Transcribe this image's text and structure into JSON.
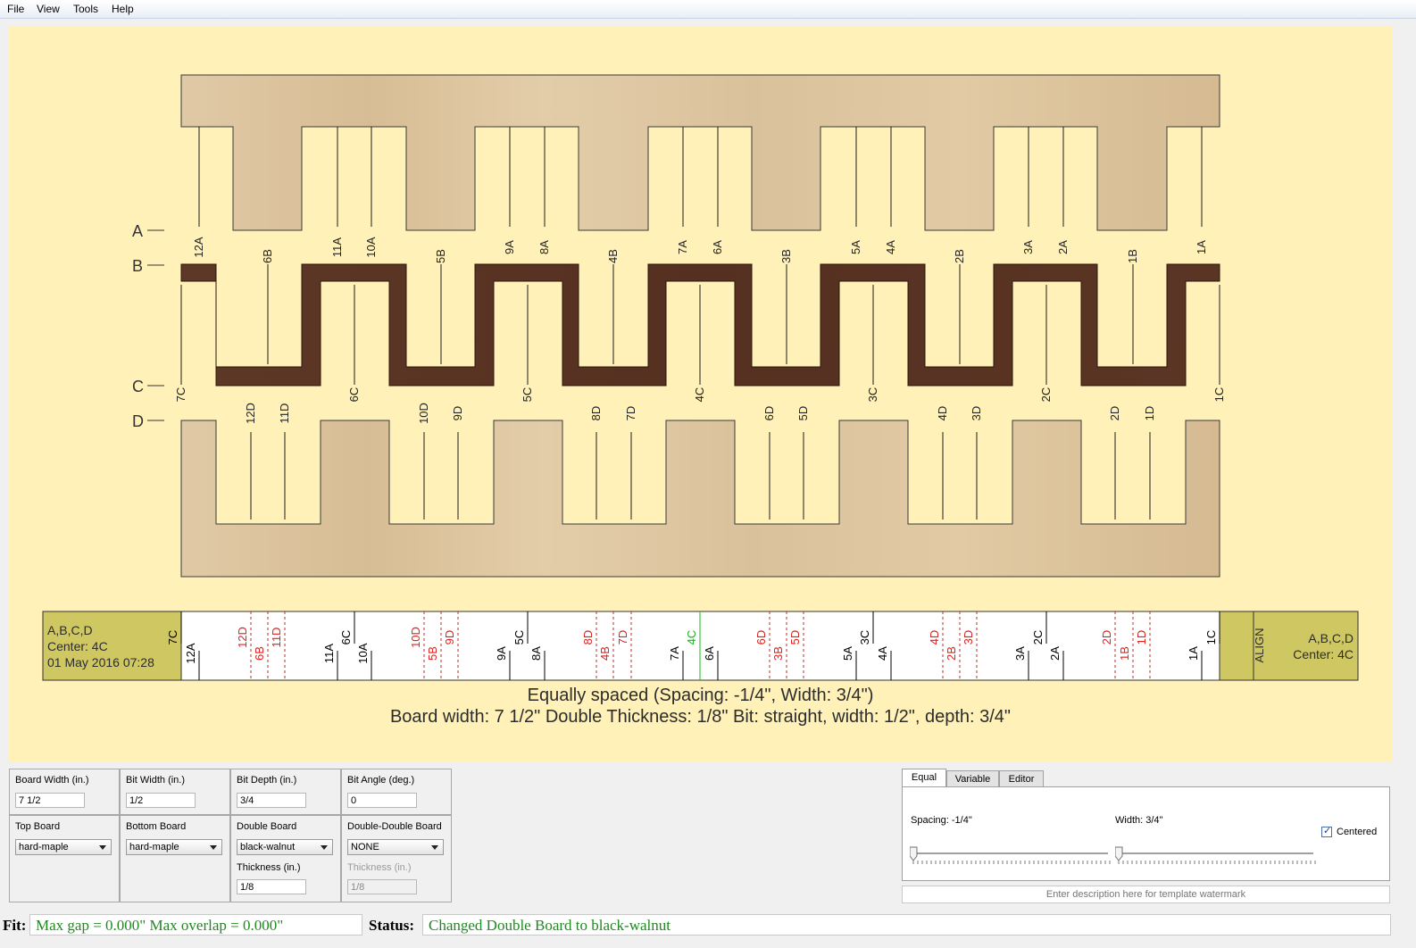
{
  "menu": [
    "File",
    "View",
    "Tools",
    "Help"
  ],
  "colors": {
    "canvas_bg": "#fff1b8",
    "maple": "#dcc49f",
    "walnut": "#5a3422",
    "cut_black": "#000000",
    "cut_red": "#e0201c",
    "center_green": "#18b818",
    "label_panel": "#cfc762"
  },
  "board_labels": [
    "A",
    "B",
    "C",
    "D"
  ],
  "board_cut_labels": {
    "A": [
      "12A",
      "11A",
      "10A",
      "9A",
      "8A",
      "7A",
      "6A",
      "5A",
      "4A",
      "3A",
      "2A",
      "1A"
    ],
    "B": [
      "6B",
      "5B",
      "4B",
      "3B",
      "2B",
      "1B"
    ],
    "C": [
      "7C",
      "6C",
      "5C",
      "4C",
      "3C",
      "2C",
      "1C"
    ],
    "D": [
      "12D",
      "11D",
      "10D",
      "9D",
      "8D",
      "7D",
      "6D",
      "5D",
      "4D",
      "3D",
      "2D",
      "1D"
    ]
  },
  "template": {
    "left_info": [
      "A,B,C,D",
      "Center: 4C",
      "01 May 2016 07:28"
    ],
    "align_label": "ALIGN",
    "right_info": [
      "A,B,C,D",
      "Center: 4C"
    ],
    "cut_labels_top": [
      "7C",
      "12D",
      "11D",
      "6C",
      "10D",
      "9D",
      "5C",
      "8D",
      "7D",
      "4C",
      "6D",
      "5D",
      "3C",
      "4D",
      "3D",
      "2C",
      "2D",
      "1D",
      "1C"
    ],
    "cut_labels_bottom": [
      "12A",
      "6B",
      "11A",
      "10A",
      "5B",
      "9A",
      "8A",
      "4B",
      "7A",
      "6A",
      "3B",
      "5A",
      "4A",
      "2B",
      "3A",
      "2A",
      "1B",
      "1A"
    ]
  },
  "info": {
    "line1": "Equally spaced (Spacing: -1/4\", Width: 3/4\")",
    "line2": "Board width: 7 1/2\"   Double Thickness: 1/8\"    Bit: straight, width: 1/2\", depth: 3/4\""
  },
  "controls": {
    "board_width": {
      "label": "Board Width (in.)",
      "value": "7 1/2"
    },
    "bit_width": {
      "label": "Bit Width (in.)",
      "value": "1/2"
    },
    "bit_depth": {
      "label": "Bit Depth (in.)",
      "value": "3/4"
    },
    "bit_angle": {
      "label": "Bit Angle (deg.)",
      "value": "0"
    },
    "top_board": {
      "label": "Top Board",
      "value": "hard-maple"
    },
    "bottom_board": {
      "label": "Bottom Board",
      "value": "hard-maple"
    },
    "double_board": {
      "label": "Double Board",
      "value": "black-walnut"
    },
    "double_thickness": {
      "label": "Thickness (in.)",
      "value": "1/8"
    },
    "dd_board": {
      "label": "Double-Double Board",
      "value": "NONE"
    },
    "dd_thickness": {
      "label": "Thickness (in.)",
      "value": "1/8"
    }
  },
  "spacing_panel": {
    "tabs": [
      "Equal",
      "Variable",
      "Editor"
    ],
    "active_tab": "Equal",
    "spacing_label": "Spacing: -1/4\"",
    "width_label": "Width: 3/4\"",
    "centered_label": "Centered",
    "centered_checked": true,
    "spacing_slider_fraction": 0.0,
    "width_slider_fraction": 0.0,
    "watermark_placeholder": "Enter description here for template watermark"
  },
  "status": {
    "fit_label": "Fit:",
    "fit_value": "Max gap = 0.000\"  Max overlap = 0.000\"",
    "status_label": "Status:",
    "status_value": "Changed Double Board to black-walnut"
  }
}
